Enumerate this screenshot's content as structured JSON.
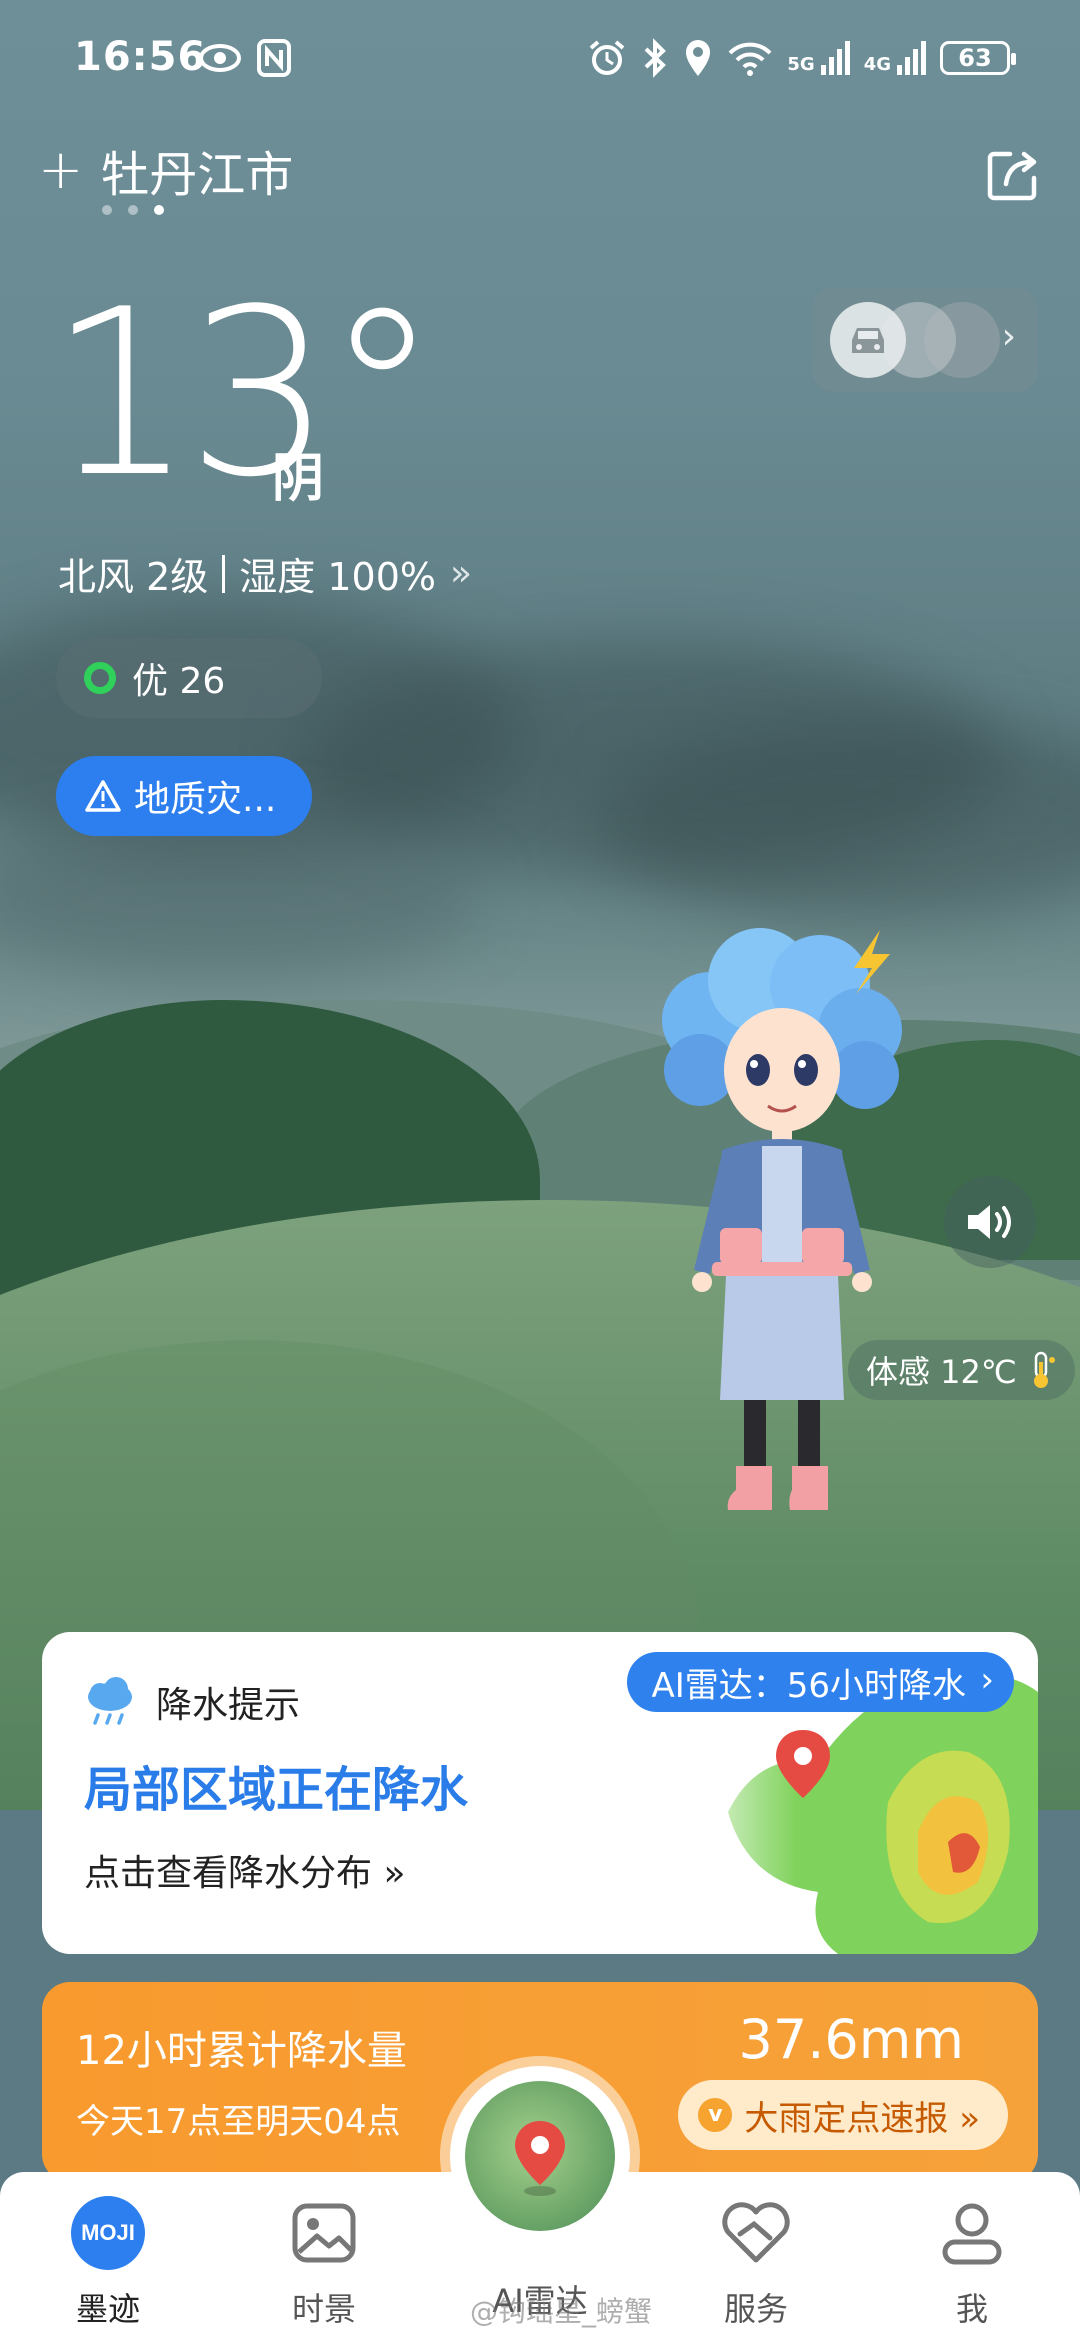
{
  "status_bar": {
    "time": "16:56",
    "battery": "63",
    "network_labels": [
      "5G",
      "4G"
    ]
  },
  "header": {
    "city": "牡丹江市",
    "page_dots": 3,
    "active_dot": 2
  },
  "weather": {
    "temperature": "13°",
    "condition": "阴",
    "wind": "北风 2级",
    "humidity": "湿度 100%",
    "aqi_label": "优 26",
    "alert_label": "地质灾..."
  },
  "character": {
    "feels_like": "体感 12℃"
  },
  "precip_card": {
    "title": "降水提示",
    "ai_radar": "AI雷达：56小时降水",
    "headline": "局部区域正在降水",
    "subtitle": "点击查看降水分布 »"
  },
  "rain_card": {
    "title": "12小时累计降水量",
    "period": "今天17点至明天04点",
    "amount": "37.6mm",
    "button_label": "大雨定点速报 »"
  },
  "bottom_nav": {
    "items": [
      {
        "label": "墨迹",
        "icon": "moji-logo-icon"
      },
      {
        "label": "时景",
        "icon": "gallery-icon"
      },
      {
        "label": "AI雷达",
        "icon": "radar-map-icon"
      },
      {
        "label": "服务",
        "icon": "heart-handshake-icon"
      },
      {
        "label": "我",
        "icon": "person-icon"
      }
    ],
    "active": 0,
    "moji_text": "MOJI"
  },
  "watermark": "@钩瑶星_螃蟹",
  "colors": {
    "accent_blue": "#2d7ff0",
    "aqi_green": "#2fd15a",
    "orange": "#f89a2e"
  }
}
